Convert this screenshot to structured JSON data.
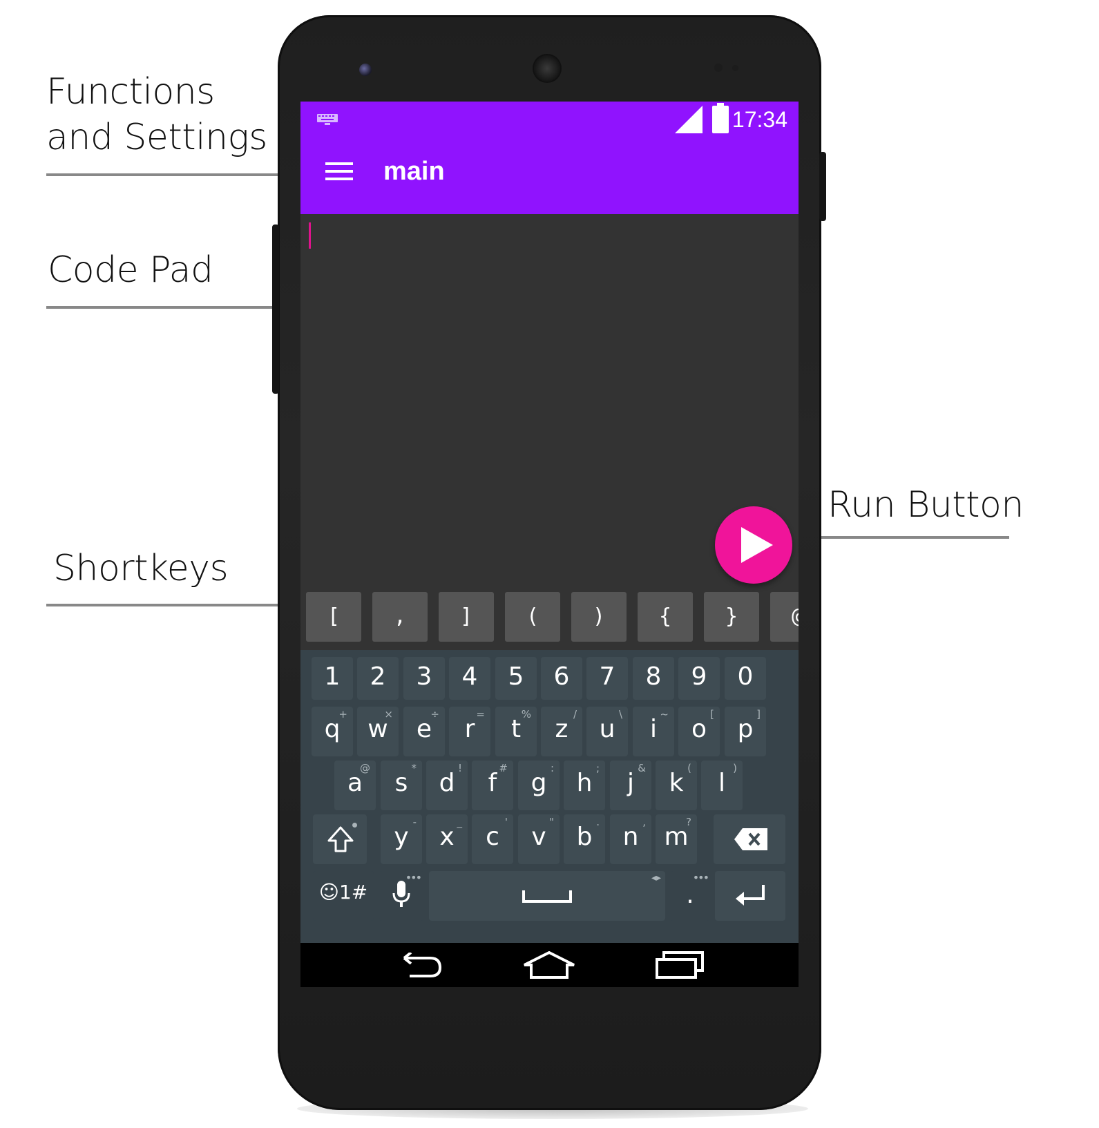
{
  "callouts": {
    "functions_line1": "Functions",
    "functions_line2": "and Settings",
    "code_pad": "Code Pad",
    "run_button": "Run Button",
    "shortkeys": "Shortkeys"
  },
  "status_bar": {
    "time": "17:34",
    "icons": [
      "keyboard-icon",
      "signal-icon",
      "battery-icon"
    ]
  },
  "app_bar": {
    "title": "main",
    "menu_icon": "hamburger-menu-icon"
  },
  "colors": {
    "accent": "#9013fe",
    "fab": "#f0149a",
    "editor_bg": "#333333",
    "keyboard_bg": "#37434a"
  },
  "shortkeys": [
    "[",
    ",",
    "]",
    "(",
    ")",
    "{",
    "}",
    "@"
  ],
  "keyboard": {
    "row_numbers": [
      "1",
      "2",
      "3",
      "4",
      "5",
      "6",
      "7",
      "8",
      "9",
      "0"
    ],
    "row1": [
      {
        "k": "q",
        "h": "+"
      },
      {
        "k": "w",
        "h": "×"
      },
      {
        "k": "e",
        "h": "÷"
      },
      {
        "k": "r",
        "h": "="
      },
      {
        "k": "t",
        "h": "%"
      },
      {
        "k": "z",
        "h": "/"
      },
      {
        "k": "u",
        "h": "\\"
      },
      {
        "k": "i",
        "h": "~"
      },
      {
        "k": "o",
        "h": "["
      },
      {
        "k": "p",
        "h": "]"
      }
    ],
    "row2": [
      {
        "k": "a",
        "h": "@"
      },
      {
        "k": "s",
        "h": "*"
      },
      {
        "k": "d",
        "h": "!"
      },
      {
        "k": "f",
        "h": "#"
      },
      {
        "k": "g",
        "h": ":"
      },
      {
        "k": "h",
        "h": ";"
      },
      {
        "k": "j",
        "h": "&"
      },
      {
        "k": "k",
        "h": "("
      },
      {
        "k": "l",
        "h": ")"
      }
    ],
    "row3": [
      {
        "k": "y",
        "h": "-"
      },
      {
        "k": "x",
        "h": "_"
      },
      {
        "k": "c",
        "h": "'"
      },
      {
        "k": "v",
        "h": "\""
      },
      {
        "k": "b",
        "h": "."
      },
      {
        "k": "n",
        "h": ","
      },
      {
        "k": "m",
        "h": "?"
      }
    ],
    "symbols_key": "☺1#",
    "period_key": "."
  }
}
